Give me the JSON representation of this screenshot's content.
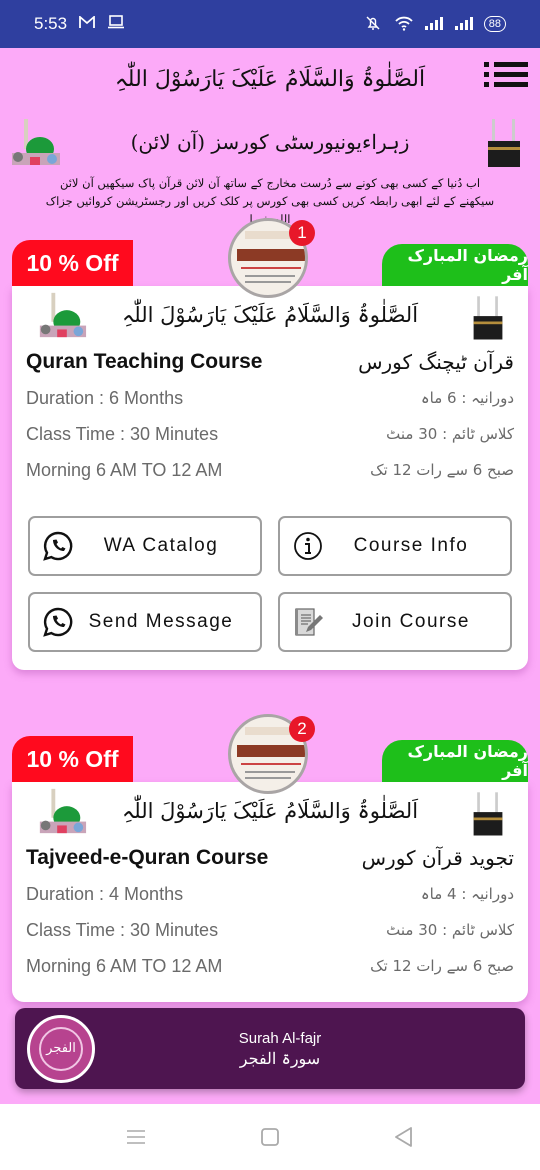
{
  "status_bar": {
    "time": "5:53",
    "left_icons": [
      "gmail-icon",
      "laptop-icon"
    ],
    "right_icons": [
      "mute-icon",
      "wifi-icon",
      "signal-icon",
      "signal-icon"
    ],
    "battery": "88"
  },
  "header": {
    "salawat": "اَلصَّلٰوۃُ وَالسَّلَامُ عَلَیْکَ یَارَسُوْلَ اللّٰہِ",
    "menu_icon": "menu-list-icon"
  },
  "subheader": {
    "title": "زہراءیونیورسٹی کورسز (آن لائن)",
    "intro_line1": "اب دُنیا کے کسی بھی کونے سے دُرست مخارج کے ساتھ آن لائن قرآن پاک سیکھیں آن لائن",
    "intro_line2": "سیکھنے کے لئے ابھی رابطہ کریں کسی بھی کورس پر کلک کریں اور رجسٹریشن کروائیں جزاک اللہ خیرا"
  },
  "courses": [
    {
      "number": "1",
      "discount": "10 % Off",
      "offer": "رمضان المبارک آفر",
      "salawat": "اَلصَّلٰوۃُ وَالسَّلَامُ عَلَیْکَ یَارَسُوْلَ اللّٰہِ",
      "title_en": "Quran Teaching Course",
      "title_ur": "قرآن ٹیچنگ کورس",
      "duration_en": "Duration : 6 Months",
      "duration_ur": "دورانیہ : 6 ماہ",
      "class_time_en": "Class Time : 30 Minutes",
      "class_time_ur": "کلاس ٹائم : 30 منٹ",
      "timing_en": "Morning 6 AM TO 12 AM",
      "timing_ur": "صبح 6 سے رات 12 تک",
      "buttons": {
        "wa_catalog": "WA Catalog",
        "course_info": "Course Info",
        "send_message": "Send Message",
        "join_course": "Join Course"
      }
    },
    {
      "number": "2",
      "discount": "10 % Off",
      "offer": "رمضان المبارک آفر",
      "salawat": "اَلصَّلٰوۃُ وَالسَّلَامُ عَلَیْکَ یَارَسُوْلَ اللّٰہِ",
      "title_en": "Tajveed-e-Quran Course",
      "title_ur": "تجوید قرآن کورس",
      "duration_en": "Duration : 4 Months",
      "duration_ur": "دورانیہ : 4 ماہ",
      "class_time_en": "Class Time : 30 Minutes",
      "class_time_ur": "کلاس ٹائم : 30 منٹ",
      "timing_en": "Morning 6 AM TO 12 AM",
      "timing_ur": "صبح 6 سے رات 12 تک"
    }
  ],
  "player": {
    "title": "Surah Al-fajr",
    "subtitle": "سورۃ الفجر",
    "art_text": "الفجر"
  },
  "colors": {
    "status_bar": "#2f3f9f",
    "page_bg": "#fcaaf8",
    "discount_badge": "#ff0a1e",
    "offer_badge": "#1ebf1a",
    "player_bg": "#4e1550"
  },
  "nav_bar": {
    "buttons": [
      "recents-icon",
      "home-icon",
      "back-icon"
    ]
  }
}
